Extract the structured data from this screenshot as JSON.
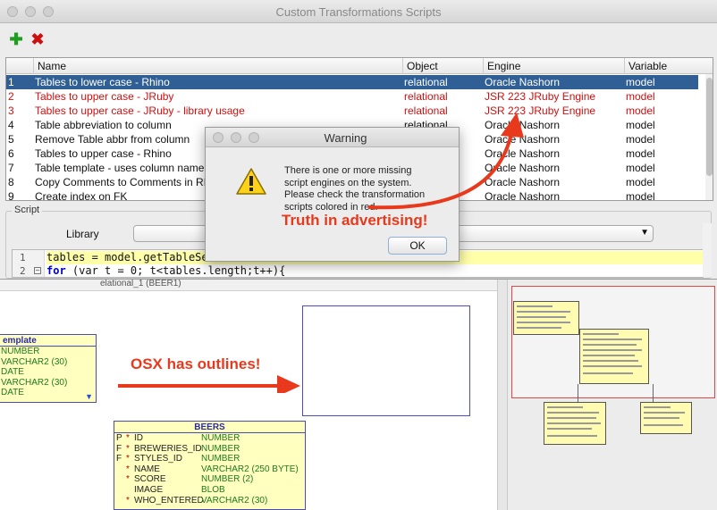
{
  "window": {
    "title": "Custom Transformations Scripts"
  },
  "toolbar": {
    "add_symbol": "✚",
    "delete_symbol": "✖",
    "add_color": "#1e9d1e",
    "delete_color": "#cc1111"
  },
  "grid": {
    "headers": {
      "num": "",
      "name": "Name",
      "object": "Object",
      "engine": "Engine",
      "variable": "Variable"
    },
    "rows": [
      {
        "num": "1",
        "name": "Tables to lower case - Rhino",
        "object": "relational",
        "engine": "Oracle Nashorn",
        "variable": "model"
      },
      {
        "num": "2",
        "name": "Tables to upper case - JRuby",
        "object": "relational",
        "engine": "JSR 223 JRuby Engine",
        "variable": "model"
      },
      {
        "num": "3",
        "name": "Tables to upper case - JRuby - library usage",
        "object": "relational",
        "engine": "JSR 223 JRuby Engine",
        "variable": "model"
      },
      {
        "num": "4",
        "name": "Table abbreviation to column",
        "object": "relational",
        "engine": "Oracle Nashorn",
        "variable": "model"
      },
      {
        "num": "5",
        "name": "Remove Table abbr from column",
        "object": "relational",
        "engine": "Oracle Nashorn",
        "variable": "model"
      },
      {
        "num": "6",
        "name": "Tables to upper case - Rhino",
        "object": "relational",
        "engine": "Oracle Nashorn",
        "variable": "model"
      },
      {
        "num": "7",
        "name": "Table template - uses column name",
        "object": "relational",
        "engine": "Oracle Nashorn",
        "variable": "model"
      },
      {
        "num": "8",
        "name": "Copy Comments to Comments in RD",
        "object": "relational",
        "engine": "Oracle Nashorn",
        "variable": "model"
      },
      {
        "num": "9",
        "name": "Create index on FK",
        "object": "relational",
        "engine": "Oracle Nashorn",
        "variable": "model"
      }
    ],
    "selected_color": "#2f5f94",
    "missing_engine_color": "#d01010"
  },
  "script": {
    "legend": "Script",
    "library_label": "Library",
    "library_value": "",
    "line_numbers": [
      "1",
      "2"
    ],
    "line1": "tables = model.getTableSet",
    "line2_for": "for",
    "line2_rest": " (var t = 0; t<tables.length;t++){"
  },
  "dialog": {
    "title": "Warning",
    "message_lines": [
      "There is one or more missing",
      "script engines on the system.",
      "Please check the transformation",
      "scripts colored in red."
    ],
    "ok_label": "OK"
  },
  "annotations": {
    "truth": "Truth in advertising!",
    "outlines": "OSX has outlines!",
    "color": "#e8391d"
  },
  "diagram": {
    "tab_label": "elational_1 (BEER1)",
    "template_table": {
      "title": "emplate",
      "rows": [
        "NUMBER",
        "VARCHAR2 (30)",
        "DATE",
        "VARCHAR2 (30)",
        "DATE"
      ]
    },
    "beers_table": {
      "title": "BEERS",
      "rows": [
        {
          "key": "P",
          "star": "*",
          "name": "ID",
          "type": "NUMBER"
        },
        {
          "key": "F",
          "star": "*",
          "name": "BREWERIES_ID",
          "type": "NUMBER"
        },
        {
          "key": "F",
          "star": "*",
          "name": "STYLES_ID",
          "type": "NUMBER"
        },
        {
          "key": "",
          "star": "*",
          "name": "NAME",
          "type": "VARCHAR2 (250 BYTE)"
        },
        {
          "key": "",
          "star": "*",
          "name": "SCORE",
          "type": "NUMBER (2)"
        },
        {
          "key": "",
          "star": "",
          "name": "IMAGE",
          "type": "BLOB"
        },
        {
          "key": "",
          "star": "*",
          "name": "WHO_ENTERED",
          "type": "VARCHAR2 (30)"
        }
      ]
    }
  }
}
